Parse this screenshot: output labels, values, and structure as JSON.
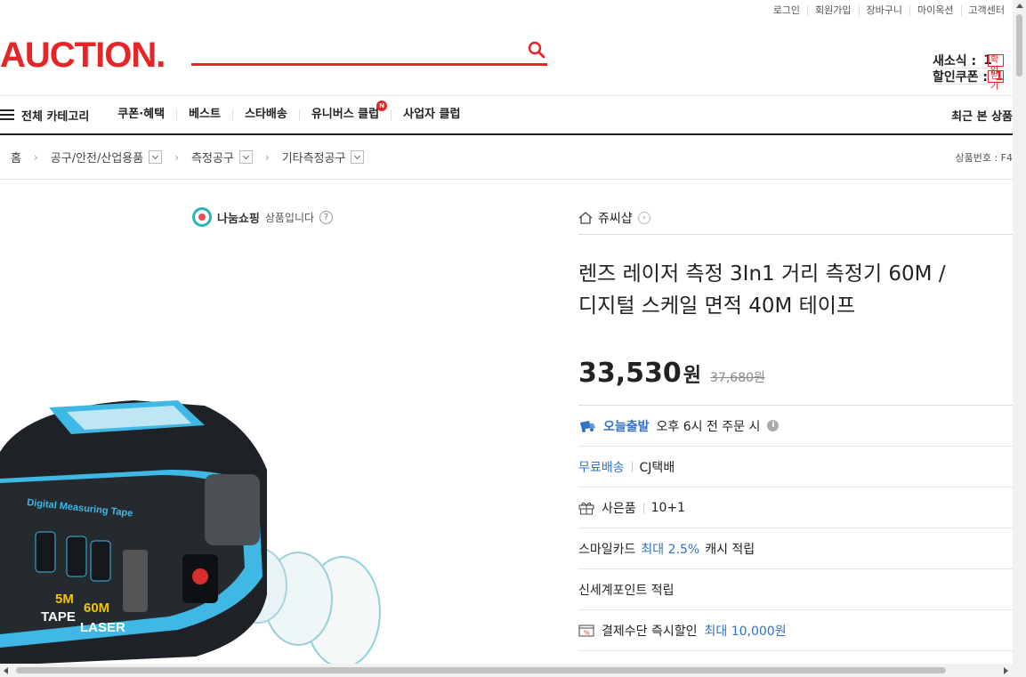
{
  "util_links": [
    "로그인",
    "회원가입",
    "장바구니",
    "마이옥션",
    "고객센터"
  ],
  "logo": "AUCTION.",
  "side": {
    "new_label": "새소식 : ",
    "new_count": "1",
    "new_btn": "확인",
    "coupon_label": "할인쿠폰 : ",
    "coupon_count": "1",
    "coupon_btn": "받기"
  },
  "nav": {
    "all_category": "전체 카테고리",
    "items": [
      "쿠폰·혜택",
      "베스트",
      "스타배송",
      "유니버스 클럽",
      "사업자 클럽"
    ],
    "new_badge": "N",
    "recent": "최근 본 상품"
  },
  "breadcrumb": {
    "home": "홈",
    "levels": [
      "공구/안전/산업용품",
      "측정공구",
      "기타측정공구"
    ],
    "product_no": "상품번호 : F4"
  },
  "nanum": {
    "brand": "나눔쇼핑",
    "text": "상품입니다",
    "help": "?"
  },
  "product": {
    "seller": "쥬씨샵",
    "title_line1": "렌즈 레이저 측정 3In1 거리 측정기 60M /",
    "title_line2": "디지털 스케일 면적 40M 테이프",
    "price": "33,530",
    "currency": "원",
    "original_price": "37,680원"
  },
  "rows": {
    "today_ship": "오늘출발",
    "today_desc": "오후 6시 전 주문 시",
    "free_ship": "무료배송",
    "courier": "CJ택배",
    "gift_label": "사은품",
    "gift_value": "10+1",
    "smile_a": "스마일카드",
    "smile_b": "최대 2.5%",
    "smile_c": "캐시 적립",
    "ssg": "신세계포인트 적립",
    "pay_a": "결제수단 즉시할인",
    "pay_b": "최대 10,000원"
  },
  "device": {
    "tape_text": "Digital Measuring Tape",
    "tape_label": "TAPE",
    "tape_len": "5M",
    "laser_label": "LASER",
    "laser_len": "60M"
  },
  "colors": {
    "brand_red": "#e52528",
    "link_blue": "#2f73c6",
    "device_blue": "#3fb8e6"
  }
}
